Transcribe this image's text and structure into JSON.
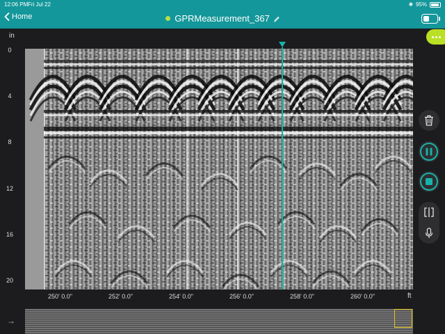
{
  "status_bar": {
    "time": "12:06 PM",
    "date": "Fri Jul 22",
    "battery_pct": "95%"
  },
  "nav": {
    "back_label": "Home",
    "title": "GPRMeasurement_367"
  },
  "depth_axis": {
    "unit": "in",
    "ticks": [
      "0",
      "4",
      "8",
      "12",
      "16",
      "20"
    ]
  },
  "distance_axis": {
    "unit": "ft",
    "ticks": [
      "250' 0.0\"",
      "252' 0.0\"",
      "254' 0.0\"",
      "256' 0.0\"",
      "258' 0.0\"",
      "260' 0.0\""
    ]
  },
  "colors": {
    "accent": "#14979a",
    "cursor": "#18b3a8",
    "more_button": "#b9e024",
    "overview_frame": "#e3c21a"
  },
  "icons": [
    "back-chevron",
    "edit-pencil",
    "battery",
    "more",
    "trash",
    "pause",
    "stop",
    "split-view",
    "microphone",
    "arrow-right"
  ]
}
